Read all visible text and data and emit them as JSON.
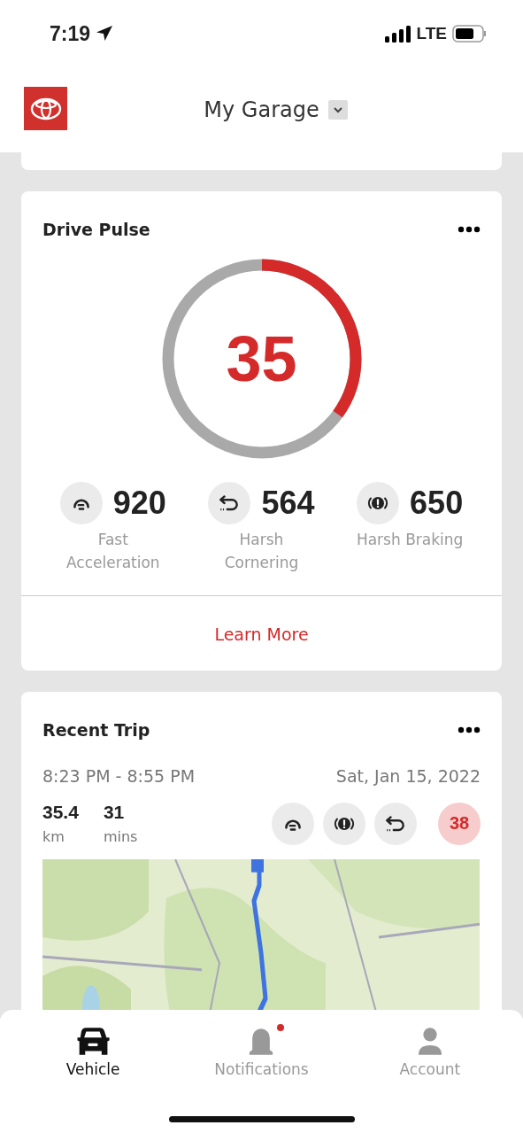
{
  "status_bar": {
    "time": "7:19",
    "network": "LTE"
  },
  "header": {
    "title": "My Garage"
  },
  "drive_pulse": {
    "title": "Drive Pulse",
    "score": "35",
    "level": 0.35,
    "metrics": [
      {
        "kind": "acceleration",
        "value": "920",
        "label": "Fast Acceleration"
      },
      {
        "kind": "cornering",
        "value": "564",
        "label": "Harsh Cornering"
      },
      {
        "kind": "braking",
        "value": "650",
        "label": "Harsh Braking"
      }
    ],
    "link": "Learn More"
  },
  "recent_trip": {
    "title": "Recent Trip",
    "time_range": "8:23 PM - 8:55 PM",
    "date": "Sat, Jan 15, 2022",
    "stats": [
      {
        "value": "35.4",
        "unit": "km"
      },
      {
        "value": "31",
        "unit": "mins"
      }
    ],
    "events": [
      {
        "kind": "acceleration"
      },
      {
        "kind": "braking"
      },
      {
        "kind": "cornering"
      }
    ],
    "score": "38"
  },
  "tabs": [
    {
      "kind": "vehicle",
      "label": "Vehicle",
      "selected": true
    },
    {
      "kind": "notifications",
      "label": "Notifications",
      "selected": false,
      "badge": true
    },
    {
      "kind": "account",
      "label": "Account",
      "selected": false,
      "badge": false
    }
  ]
}
